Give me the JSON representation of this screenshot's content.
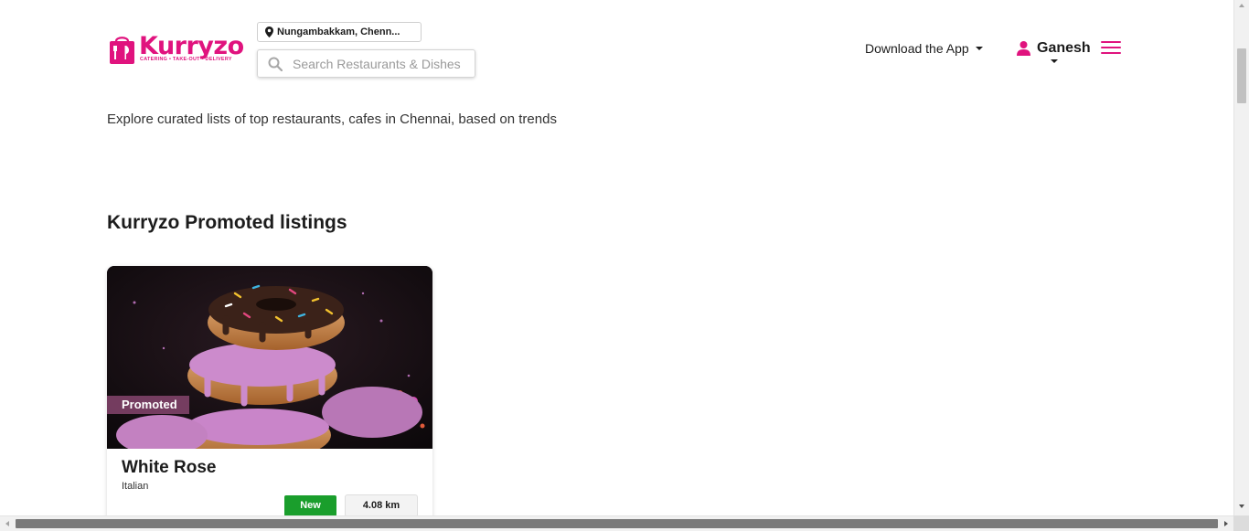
{
  "brand": {
    "name": "Kurryzo",
    "tagline": "CATERING • TAKE-OUT • DELIVERY",
    "accent_color": "#e0137e"
  },
  "header": {
    "location": "Nungambakkam, Chenn...",
    "search_placeholder": "Search Restaurants & Dishes",
    "download_label": "Download the App",
    "user_name": "Ganesh",
    "icons": [
      "location-pin-icon",
      "search-icon",
      "user-icon",
      "hamburger-menu-icon"
    ]
  },
  "main": {
    "tagline": "Explore curated lists of top restaurants, cafes in Chennai, based on trends",
    "section_title": "Kurryzo Promoted listings",
    "listings": [
      {
        "tag": "Promoted",
        "name": "White Rose",
        "cuisine": "Italian",
        "status": "New",
        "distance": "4.08 km",
        "status_color": "#1a9e2c"
      }
    ]
  }
}
